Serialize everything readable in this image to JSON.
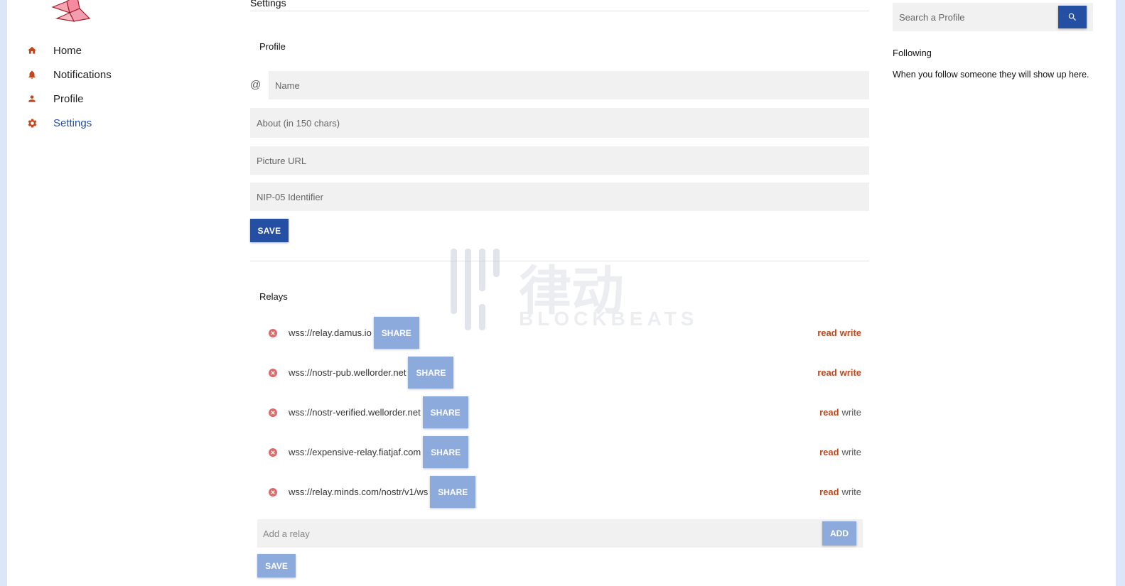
{
  "sidebar": {
    "items": [
      {
        "label": "Home",
        "icon": "home-icon",
        "active": false
      },
      {
        "label": "Notifications",
        "icon": "bell-icon",
        "active": false
      },
      {
        "label": "Profile",
        "icon": "person-icon",
        "active": false
      },
      {
        "label": "Settings",
        "icon": "gear-icon",
        "active": true
      }
    ]
  },
  "main": {
    "title": "Settings",
    "profile": {
      "section_title": "Profile",
      "at_symbol": "@",
      "name_placeholder": "Name",
      "about_placeholder": "About (in 150 chars)",
      "picture_placeholder": "Picture URL",
      "nip05_placeholder": "NIP-05 Identifier",
      "save_label": "SAVE"
    },
    "relays": {
      "section_title": "Relays",
      "share_label": "SHARE",
      "read_label": "read",
      "write_label": "write",
      "items": [
        {
          "url": "wss://relay.damus.io",
          "read": true,
          "write": true
        },
        {
          "url": "wss://nostr-pub.wellorder.net",
          "read": true,
          "write": true
        },
        {
          "url": "wss://nostr-verified.wellorder.net",
          "read": true,
          "write": false
        },
        {
          "url": "wss://expensive-relay.fiatjaf.com",
          "read": true,
          "write": false
        },
        {
          "url": "wss://relay.minds.com/nostr/v1/ws",
          "read": true,
          "write": false
        }
      ],
      "add_placeholder": "Add a relay",
      "add_label": "ADD",
      "save_label": "SAVE"
    }
  },
  "right": {
    "search_placeholder": "Search a Profile",
    "following_title": "Following",
    "following_empty": "When you follow someone they will show up here."
  },
  "watermark": {
    "cn": "律动",
    "en": "BLOCKBEATS"
  },
  "colors": {
    "accent": "#244fa3",
    "accent_light": "#8daadc",
    "icon_red": "#c0481e",
    "remove_red": "#e06a6a"
  }
}
